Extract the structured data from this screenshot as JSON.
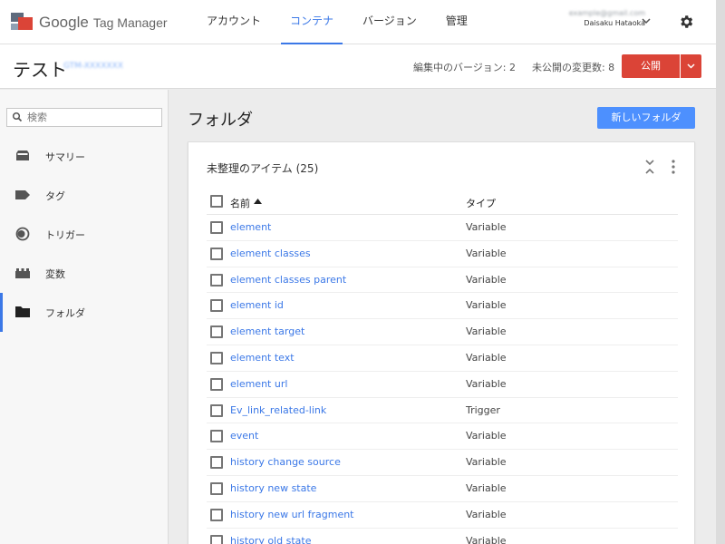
{
  "app": {
    "brand_google": "Google",
    "brand_product": "Tag Manager"
  },
  "nav": {
    "items": [
      {
        "label": "アカウント"
      },
      {
        "label": "コンテナ"
      },
      {
        "label": "バージョン"
      },
      {
        "label": "管理"
      }
    ],
    "active_index": 1
  },
  "account": {
    "email": "example@gmail.com",
    "name": "Daisaku Hataoka"
  },
  "container": {
    "name": "テスト",
    "id": "GTM-XXXXXXX",
    "editing_version": "編集中のバージョン: 2",
    "unpublished_changes": "未公開の変更数: 8",
    "publish_label": "公開"
  },
  "sidebar": {
    "search_placeholder": "検索",
    "items": [
      {
        "label": "サマリー",
        "icon": "summary-icon"
      },
      {
        "label": "タグ",
        "icon": "tag-icon"
      },
      {
        "label": "トリガー",
        "icon": "trigger-icon"
      },
      {
        "label": "変数",
        "icon": "variables-icon"
      },
      {
        "label": "フォルダ",
        "icon": "folder-icon"
      }
    ],
    "active_index": 4
  },
  "main": {
    "title": "フォルダ",
    "new_folder_label": "新しいフォルダ",
    "card": {
      "title": "未整理のアイテム (25)",
      "columns": {
        "name": "名前",
        "type": "タイプ"
      },
      "rows": [
        {
          "name": "element",
          "type": "Variable"
        },
        {
          "name": "element classes",
          "type": "Variable"
        },
        {
          "name": "element classes parent",
          "type": "Variable"
        },
        {
          "name": "element id",
          "type": "Variable"
        },
        {
          "name": "element target",
          "type": "Variable"
        },
        {
          "name": "element text",
          "type": "Variable"
        },
        {
          "name": "element url",
          "type": "Variable"
        },
        {
          "name": "Ev_link_related-link",
          "type": "Trigger"
        },
        {
          "name": "event",
          "type": "Variable"
        },
        {
          "name": "history change source",
          "type": "Variable"
        },
        {
          "name": "history new state",
          "type": "Variable"
        },
        {
          "name": "history new url fragment",
          "type": "Variable"
        },
        {
          "name": "history old state",
          "type": "Variable"
        }
      ]
    }
  },
  "colors": {
    "accent": "#3b78e7",
    "publish": "#db4437",
    "new_button": "#4d90fe"
  }
}
